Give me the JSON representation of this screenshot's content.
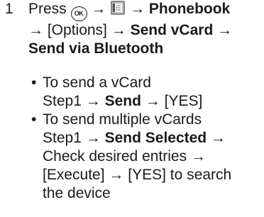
{
  "step": {
    "number": "1",
    "press": "Press",
    "ok_key": "OK",
    "arrow": "→",
    "phonebook": "Phonebook",
    "options": "[Options]",
    "send_vcard": "Send vCard",
    "send_bt": "Send via Bluetooth"
  },
  "sub1": {
    "title": "To send a vCard",
    "step_ref": "Step1",
    "send": "Send",
    "yes": "[YES]"
  },
  "sub2": {
    "title": "To send multiple vCards",
    "step_ref": "Step1",
    "send_selected": "Send Selected",
    "check": "Check desired entries",
    "execute": "[Execute]",
    "yes": "[YES]",
    "search1": "to search",
    "search2": "the device"
  },
  "icons": {
    "ok": "ok-key-icon",
    "phonebook": "phonebook-icon"
  }
}
